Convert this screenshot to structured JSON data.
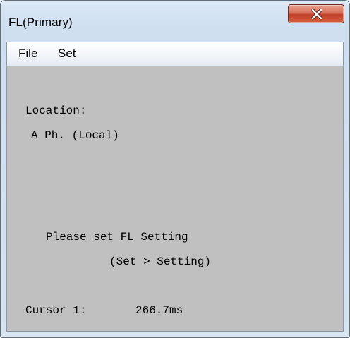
{
  "window": {
    "title": "FL(Primary)"
  },
  "menu": {
    "file_label": "File",
    "set_label": "Set"
  },
  "content": {
    "location_label": "Location:",
    "location_value": "A Ph. (Local)",
    "message_line1": "Please set FL Setting",
    "message_line2": "(Set > Setting)",
    "cursor_label": "Cursor 1:",
    "cursor_value": "266.7ms"
  },
  "colors": {
    "content_background": "#c0c0c0",
    "close_button": "#c7432c"
  },
  "icons": {
    "close": "close-icon"
  }
}
